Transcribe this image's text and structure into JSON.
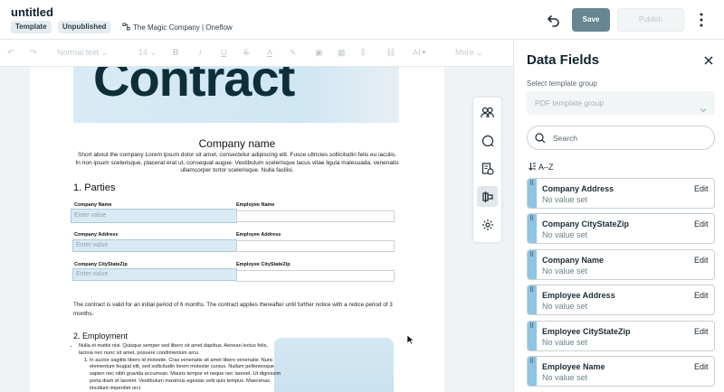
{
  "header": {
    "title": "untitled",
    "chip_template": "Template",
    "chip_unpublished": "Unpublished",
    "company": "The Magic Company | Oneflow",
    "save_label": "Save",
    "publish_label": "Publish"
  },
  "toolbar": {
    "style_select": "Normal text",
    "size_select": "14",
    "ai_label": "AI",
    "more_label": "More"
  },
  "document": {
    "hero_text": "Contract",
    "company_name": "Company name",
    "about": "Short about the company Lorem ipsum dolor sit amet, consectetur adipiscing elit. Fusce ultricies sollicitudin felis eu iaculis. In non ipsum scelerisque, placerat erat ut, consequat augue. Vestibulum scelerisque lacus vitae ligula malesuada, venenatis ullamcorper tortor scelerisque. Nulla facilisi.",
    "parties_title": "1. Parties",
    "fields": [
      {
        "label": "Company Name",
        "value": "Enter value"
      },
      {
        "label": "Employee Name",
        "value": ""
      },
      {
        "label": "Company Address",
        "value": "Enter value"
      },
      {
        "label": "Employee Address",
        "value": ""
      },
      {
        "label": "Company CityStateZip",
        "value": "Enter value"
      },
      {
        "label": "Employee CityStateZip",
        "value": ""
      }
    ],
    "validity": "The contract is valid for an initial period of 6 months. The contract applies thereafter until further notice with a notice period of 3 months.",
    "employment_title": "2. Employment",
    "employment_bullet": "Nulla et mattis nisi. Quisque semper sed libero sit amet dapibus. Aenean lectus felis, lacinia nec nunc sit amet, posuere condimentum arcu.",
    "employment_sub": "In auctor sagittis libero id molestie. Cras venenatis sit amet libero venenatis. Nunc elementum feugiat elit, sed sollicitudin lorem molestie cursus. Nullam pellentesque sapien nec nibh gravida accumsan. Mauris tempor et neque nec laoreet. Ut dignissim porta diam et laoreet. Vestibulum maximus egestas velit quis tempus. Maecenas tincidunt imperdiet orci."
  },
  "panel": {
    "title": "Data Fields",
    "group_label": "Select template group",
    "group_placeholder": "PDF template group",
    "search_placeholder": "Search",
    "sort_label": "A–Z",
    "edit_label": "Edit",
    "fields": [
      {
        "name": "Company Address",
        "value": "No value set"
      },
      {
        "name": "Company CityStateZip",
        "value": "No value set"
      },
      {
        "name": "Company Name",
        "value": "No value set"
      },
      {
        "name": "Employee Address",
        "value": "No value set"
      },
      {
        "name": "Employee CityStateZip",
        "value": "No value set"
      },
      {
        "name": "Employee Name",
        "value": "No value set"
      }
    ]
  },
  "colors": {
    "accent_bar": "#8fc4e3",
    "save_button": "#678691",
    "hero_bg": "#d8ebf5"
  },
  "icons": [
    "undo-icon",
    "kebab-menu-icon",
    "link-icon",
    "participants-icon",
    "comment-icon",
    "document-history-icon",
    "data-fields-icon",
    "settings-icon",
    "close-icon",
    "search-icon",
    "sort-az-icon",
    "drag-handle-icon",
    "chevron-down-icon"
  ]
}
